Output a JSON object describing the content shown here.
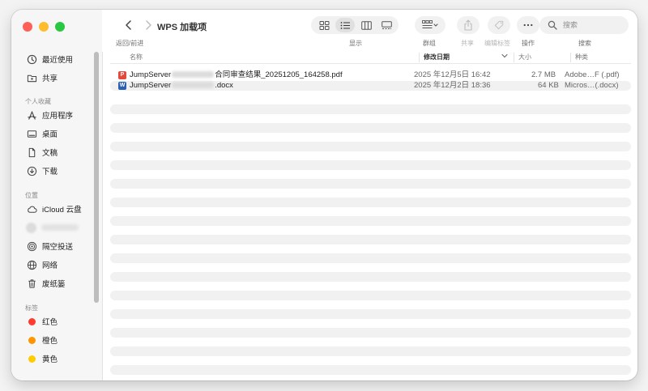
{
  "window": {
    "title": "WPS 加载项"
  },
  "sidebar": {
    "recent": {
      "label": "最近使用",
      "icon": "clock-icon"
    },
    "shared": {
      "label": "共享",
      "icon": "shared-folder-icon"
    },
    "favorites": {
      "title": "个人收藏",
      "items": [
        {
          "label": "应用程序",
          "icon": "applications-icon"
        },
        {
          "label": "桌面",
          "icon": "desktop-icon"
        },
        {
          "label": "文稿",
          "icon": "document-icon"
        },
        {
          "label": "下载",
          "icon": "download-icon"
        }
      ]
    },
    "locations": {
      "title": "位置",
      "items": [
        {
          "label": "iCloud 云盘",
          "icon": "cloud-icon"
        },
        {
          "label": "隔空投送",
          "icon": "airdrop-icon"
        },
        {
          "label": "网络",
          "icon": "network-icon"
        },
        {
          "label": "废纸篓",
          "icon": "trash-icon"
        }
      ]
    },
    "tags": {
      "title": "标签",
      "items": [
        {
          "label": "红色",
          "color": "#ff3b30"
        },
        {
          "label": "橙色",
          "color": "#ff9500"
        },
        {
          "label": "黄色",
          "color": "#ffcc00"
        }
      ]
    }
  },
  "toolbar": {
    "nav_label": "返回/前进",
    "view_label": "显示",
    "group_label": "群组",
    "share_label": "共享",
    "tags_label": "编辑标签",
    "actions_label": "操作",
    "search_label": "搜索",
    "search_placeholder": "搜索"
  },
  "columns": {
    "name": "名称",
    "date": "修改日期",
    "size": "大小",
    "kind": "种类"
  },
  "files": [
    {
      "name_prefix": "JumpServer",
      "name_suffix": "合同审查结果_20251205_164258.pdf",
      "date": "2025 年12月5日 16:42",
      "size": "2.7 MB",
      "kind": "Adobe…F (.pdf)",
      "icon": "pdf-file-icon",
      "icon_glyph": "P"
    },
    {
      "name_prefix": "JumpServer",
      "name_suffix": ".docx",
      "date": "2025 年12月2日 18:36",
      "size": "64 KB",
      "kind": "Micros…(.docx)",
      "icon": "word-file-icon",
      "icon_glyph": "W"
    }
  ],
  "colors": {
    "accent": "#2b5fb3",
    "pdf": "#e24a3b",
    "stripe": "#f1f1f2"
  }
}
